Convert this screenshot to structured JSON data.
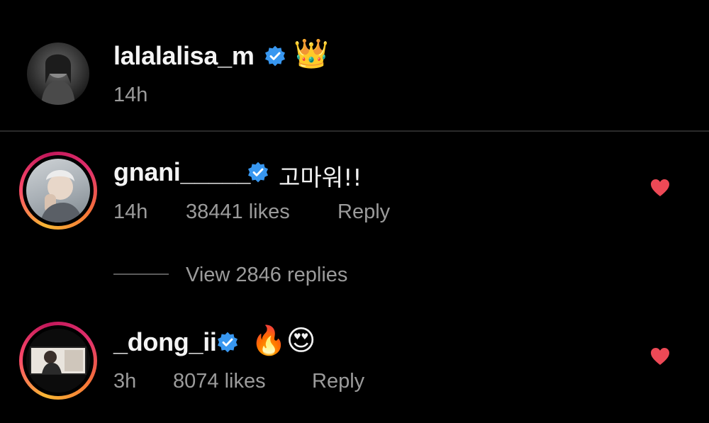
{
  "post": {
    "username": "lalalalisa_m",
    "time": "14h",
    "emoji": "👑"
  },
  "comments": [
    {
      "username": "gnani_____",
      "text": "고마워!!",
      "time": "14h",
      "likes": "38441 likes",
      "reply": "Reply",
      "view_replies": "View 2846 replies"
    },
    {
      "username": "_dong_ii",
      "text": "🔥😍",
      "time": "3h",
      "likes": "8074 likes",
      "reply": "Reply"
    }
  ],
  "colors": {
    "background": "#000000",
    "verified": "#3897f0",
    "heart": "#ed4956",
    "meta_text": "#9b9b9b"
  },
  "icons": [
    "verified-badge-icon",
    "heart-icon",
    "crown-emoji",
    "fire-emoji",
    "heart-eyes-emoji"
  ]
}
